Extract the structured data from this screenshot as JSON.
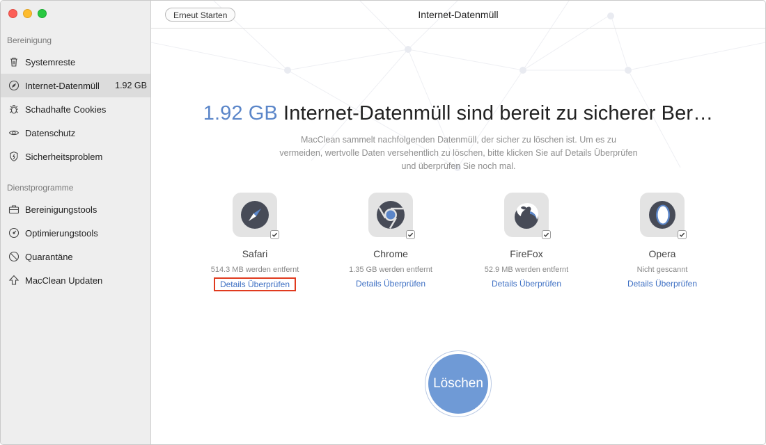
{
  "window": {
    "title": "Internet-Datenmüll",
    "restart_label": "Erneut Starten"
  },
  "sidebar": {
    "sections": [
      {
        "title": "Bereinigung",
        "items": [
          {
            "label": "Systemreste",
            "icon": "trash-icon"
          },
          {
            "label": "Internet-Datenmüll",
            "icon": "compass-icon",
            "size": "1.92 GB",
            "active": true
          },
          {
            "label": "Schadhafte Cookies",
            "icon": "bug-icon"
          },
          {
            "label": "Datenschutz",
            "icon": "eye-icon"
          },
          {
            "label": "Sicherheitsproblem",
            "icon": "shield-icon"
          }
        ]
      },
      {
        "title": "Dienstprogramme",
        "items": [
          {
            "label": "Bereinigungstools",
            "icon": "toolbox-icon"
          },
          {
            "label": "Optimierungstools",
            "icon": "gauge-icon"
          },
          {
            "label": "Quarantäne",
            "icon": "quarantine-icon"
          },
          {
            "label": "MacClean Updaten",
            "icon": "arrow-up-icon"
          }
        ]
      }
    ]
  },
  "main": {
    "amount": "1.92 GB",
    "headline": " Internet-Datenmüll sind bereit zu sicherer Ber…",
    "description": "MacClean sammelt nachfolgenden Datenmüll, der sicher zu löschen ist. Um es zu vermeiden, wertvolle Daten versehentlich zu löschen, bitte klicken Sie auf Details Überprüfen und überprüfen Sie noch mal.",
    "browsers": [
      {
        "name": "Safari",
        "status": "514.3 MB werden entfernt",
        "details": "Details Überprüfen",
        "icon": "safari-icon",
        "checked": true
      },
      {
        "name": "Chrome",
        "status": "1.35 GB werden entfernt",
        "details": "Details Überprüfen",
        "icon": "chrome-icon",
        "checked": true
      },
      {
        "name": "FireFox",
        "status": "52.9 MB werden entfernt",
        "details": "Details Überprüfen",
        "icon": "firefox-icon",
        "checked": true
      },
      {
        "name": "Opera",
        "status": "Nicht gescannt",
        "details": "Details Überprüfen",
        "icon": "opera-icon",
        "checked": true
      }
    ],
    "delete_label": "Löschen"
  },
  "colors": {
    "accent": "#5b86c9",
    "link": "#3d6fc3",
    "delete_button": "#6f9ad6",
    "highlight_border": "#e03a1e"
  }
}
